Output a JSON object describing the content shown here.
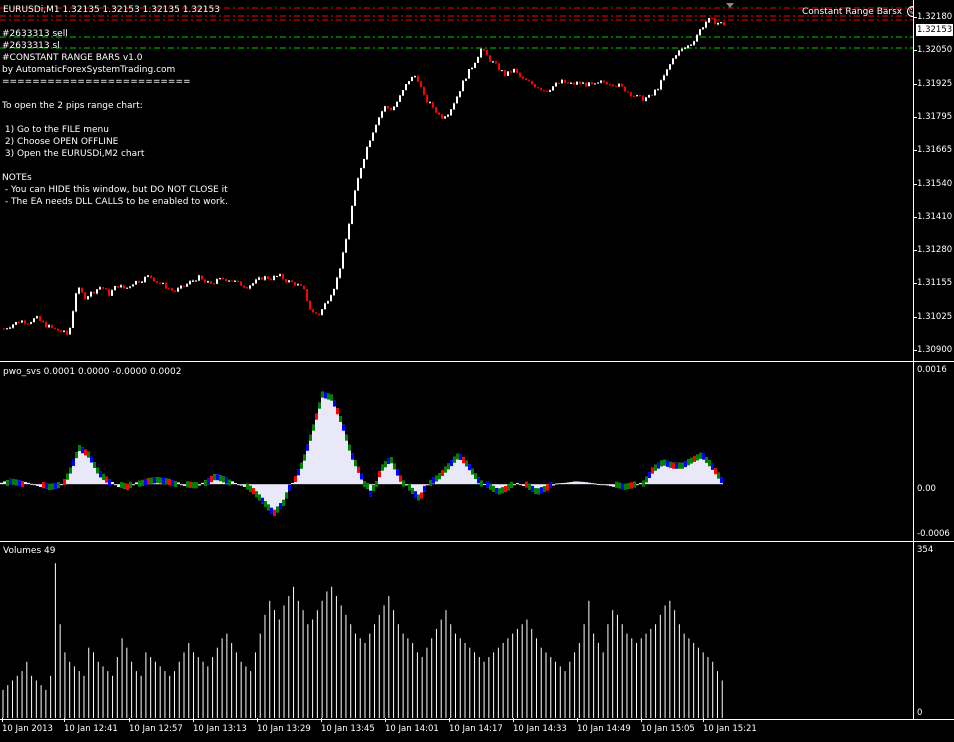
{
  "main": {
    "header": "EURUSDi,M1  1.32135 1.32153 1.32135 1.32153",
    "panel_title": "Constant Range Bars",
    "panel_close": "x",
    "panel_icon": "smiley-icon",
    "current_price": "1.32153",
    "price_axis": [
      "1.32180",
      "1.32050",
      "1.31925",
      "1.31795",
      "1.31665",
      "1.31540",
      "1.31410",
      "1.31280",
      "1.31155",
      "1.31025",
      "1.30900"
    ],
    "info_lines": [
      "#2633313 sell",
      "#2633313 sl",
      "#CONSTANT RANGE BARS v1.0",
      "by AutomaticForexSystemTrading.com",
      "=========================",
      "",
      "To open the 2 pips range chart:",
      "",
      " 1) Go to the FILE menu",
      " 2) Choose OPEN OFFLINE",
      " 3) Open the EURUSDi,M2 chart",
      "",
      "NOTEs",
      " - You can HIDE this window, but DO NOT CLOSE it",
      " - The EA needs DLL CALLS to be enabled to work."
    ],
    "header_separator": "========================="
  },
  "indicator": {
    "header": "pwo_svs 0.0001 0.0000 -0.0000 0.0002",
    "axis": [
      "0.0016",
      "0.00",
      "-0.0006"
    ]
  },
  "volumes": {
    "header": "Volumes 49",
    "axis": [
      "354",
      "0"
    ]
  },
  "time_axis": [
    "10 Jan 2013",
    "10 Jan 12:41",
    "10 Jan 12:57",
    "10 Jan 13:13",
    "10 Jan 13:29",
    "10 Jan 13:45",
    "10 Jan 14:01",
    "10 Jan 14:17",
    "10 Jan 14:33",
    "10 Jan 14:49",
    "10 Jan 15:05",
    "10 Jan 15:21"
  ],
  "colors": {
    "bull": "#ffffff",
    "bear": "#ff0000",
    "osc_fill": "#e8e8f8",
    "osc_green": "#008000",
    "osc_blue": "#0000ff",
    "osc_red": "#ff0000",
    "level_red": "#ff0000",
    "level_green": "#00cc00"
  },
  "chart_data": [
    {
      "type": "candlestick",
      "symbol": "EURUSDi,M1",
      "ylim": [
        1.309,
        1.3218
      ],
      "close_path": [
        1.31,
        1.31015,
        1.3103,
        1.31025,
        1.3104,
        1.31015,
        1.31,
        1.3099,
        1.30975,
        1.31155,
        1.3112,
        1.3114,
        1.3116,
        1.3113,
        1.31165,
        1.3115,
        1.31175,
        1.31185,
        1.312,
        1.31175,
        1.3116,
        1.3114,
        1.31155,
        1.31175,
        1.31195,
        1.3117,
        1.31175,
        1.3119,
        1.31185,
        1.3117,
        1.3116,
        1.31175,
        1.31195,
        1.3119,
        1.312,
        1.3118,
        1.3117,
        1.3115,
        1.3106,
        1.31055,
        1.3111,
        1.3117,
        1.3129,
        1.3146,
        1.316,
        1.317,
        1.3178,
        1.3184,
        1.3183,
        1.3188,
        1.3194,
        1.3196,
        1.3187,
        1.3184,
        1.318,
        1.3182,
        1.3188,
        1.3195,
        1.32,
        1.3206,
        1.3202,
        1.3199,
        1.3196,
        1.3198,
        1.31945,
        1.3193,
        1.31915,
        1.319,
        1.3192,
        1.31935,
        1.31925,
        1.3193,
        1.31925,
        1.3192,
        1.31935,
        1.3193,
        1.3192,
        1.319,
        1.3188,
        1.3187,
        1.3188,
        1.3192,
        1.3198,
        1.3204,
        1.3206,
        1.3208,
        1.3213,
        1.3217,
        1.3216,
        1.32153
      ]
    },
    {
      "type": "area",
      "name": "pwo_svs",
      "ylim": [
        -0.0006,
        0.0016
      ],
      "values": [
        2e-05,
        8e-05,
        5e-05,
        1e-05,
        -4e-05,
        -8e-05,
        -5e-05,
        0.0002,
        0.00055,
        0.00045,
        0.0002,
        8e-05,
        -4e-05,
        -8e-05,
        4e-05,
        8e-05,
        0.0001,
        8e-05,
        4e-05,
        -4e-05,
        -6e-05,
        6e-05,
        0.00015,
        0.0001,
        2e-05,
        -4e-05,
        -0.00015,
        -0.0003,
        -0.00045,
        -0.0003,
        5e-05,
        0.00035,
        0.0008,
        0.0013,
        0.00125,
        0.0009,
        0.00045,
        0.00015,
        -0.0002,
        0.00025,
        0.0004,
        0.00012,
        -0.0001,
        -0.00025,
        5e-05,
        0.00015,
        0.0003,
        0.00045,
        0.0003,
        0.0001,
        -5e-05,
        -0.00015,
        -0.0001,
        2e-05,
        -5e-05,
        -0.00015,
        -0.0001,
        1e-05,
        2e-05,
        4e-05,
        3e-05,
        1e-05,
        -1e-05,
        -4e-05,
        -8e-05,
        -5e-05,
        5e-05,
        0.00025,
        0.00035,
        0.0003,
        0.0003,
        0.00038,
        0.00045,
        0.0003,
        0.0001
      ]
    },
    {
      "type": "bar",
      "name": "Volumes",
      "ylim": [
        0,
        354
      ],
      "values": [
        60,
        70,
        80,
        90,
        100,
        120,
        90,
        80,
        70,
        60,
        90,
        330,
        200,
        140,
        120,
        110,
        100,
        90,
        150,
        140,
        120,
        110,
        100,
        90,
        130,
        170,
        150,
        120,
        100,
        90,
        140,
        130,
        120,
        110,
        100,
        90,
        100,
        120,
        140,
        160,
        140,
        130,
        120,
        110,
        130,
        150,
        170,
        180,
        160,
        140,
        120,
        110,
        100,
        140,
        180,
        220,
        250,
        230,
        210,
        240,
        260,
        280,
        250,
        230,
        200,
        210,
        230,
        250,
        270,
        280,
        260,
        240,
        220,
        200,
        180,
        170,
        160,
        180,
        200,
        220,
        240,
        260,
        230,
        200,
        180,
        170,
        160,
        140,
        130,
        150,
        170,
        190,
        210,
        230,
        200,
        180,
        170,
        160,
        150,
        140,
        130,
        120,
        130,
        140,
        150,
        160,
        170,
        180,
        190,
        200,
        210,
        190,
        170,
        150,
        140,
        130,
        120,
        110,
        100,
        120,
        140,
        160,
        200,
        250,
        180,
        160,
        140,
        200,
        230,
        220,
        200,
        180,
        170,
        160,
        170,
        180,
        190,
        200,
        220,
        240,
        250,
        230,
        200,
        180,
        170,
        160,
        150,
        140,
        130,
        120,
        100,
        80
      ]
    }
  ]
}
